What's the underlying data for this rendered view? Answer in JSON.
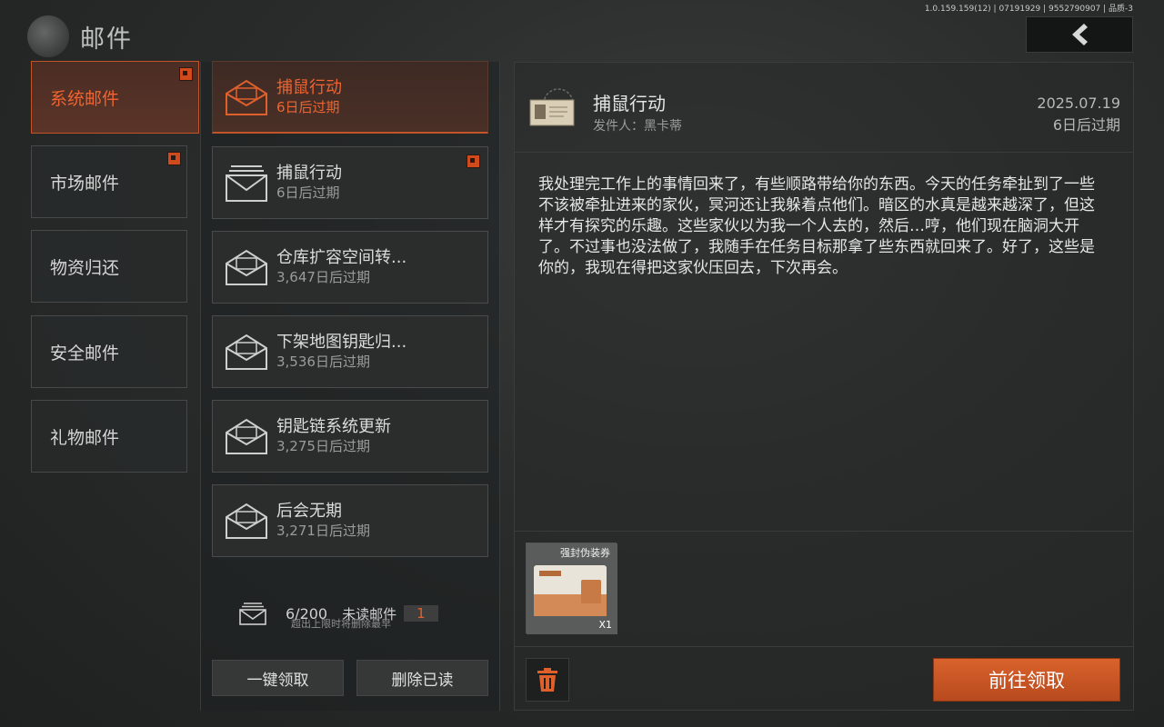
{
  "header": {
    "title": "邮件",
    "version": "1.0.159.159(12) | 07191929 | 9552790907 | 品质-3"
  },
  "categories": [
    {
      "label": "系统邮件",
      "active": true,
      "badge": true
    },
    {
      "label": "市场邮件",
      "active": false,
      "badge": true
    },
    {
      "label": "物资归还",
      "active": false,
      "badge": false
    },
    {
      "label": "安全邮件",
      "active": false,
      "badge": false
    },
    {
      "label": "礼物邮件",
      "active": false,
      "badge": false
    }
  ],
  "mails": [
    {
      "title": "捕鼠行动",
      "expire": "6日后过期",
      "active": true,
      "opened": false,
      "badge": false
    },
    {
      "title": "捕鼠行动",
      "expire": "6日后过期",
      "active": false,
      "opened": false,
      "badge": true
    },
    {
      "title": "仓库扩容空间转...",
      "expire": "3,647日后过期",
      "active": false,
      "opened": true,
      "badge": false
    },
    {
      "title": "下架地图钥匙归...",
      "expire": "3,536日后过期",
      "active": false,
      "opened": true,
      "badge": false
    },
    {
      "title": "钥匙链系统更新",
      "expire": "3,275日后过期",
      "active": false,
      "opened": true,
      "badge": false
    },
    {
      "title": "后会无期",
      "expire": "3,271日后过期",
      "active": false,
      "opened": true,
      "badge": false
    }
  ],
  "footer": {
    "count": "6/200",
    "unread_label": "未读邮件",
    "unread_count": "1",
    "limit_note": "超出上限时将删除最早",
    "claim_all": "一键领取",
    "delete_read": "删除已读"
  },
  "detail": {
    "title": "捕鼠行动",
    "sender": "发件人：黑卡蒂",
    "date": "2025.07.19",
    "expire": "6日后过期",
    "body": "我处理完工作上的事情回来了，有些顺路带给你的东西。今天的任务牵扯到了一些不该被牵扯进来的家伙，冥河还让我躲着点他们。暗区的水真是越来越深了，但这样才有探究的乐趣。这些家伙以为我一个人去的，然后…哼，他们现在脑洞大开了。不过事也没法做了，我随手在任务目标那拿了些东西就回来了。好了，这些是你的，我现在得把这家伙压回去，下次再会。",
    "attachment": {
      "name": "强封伪装券",
      "qty": "X1"
    },
    "claim": "前往领取"
  },
  "colors": {
    "accent": "#e0602c",
    "button": "#c8552a"
  }
}
